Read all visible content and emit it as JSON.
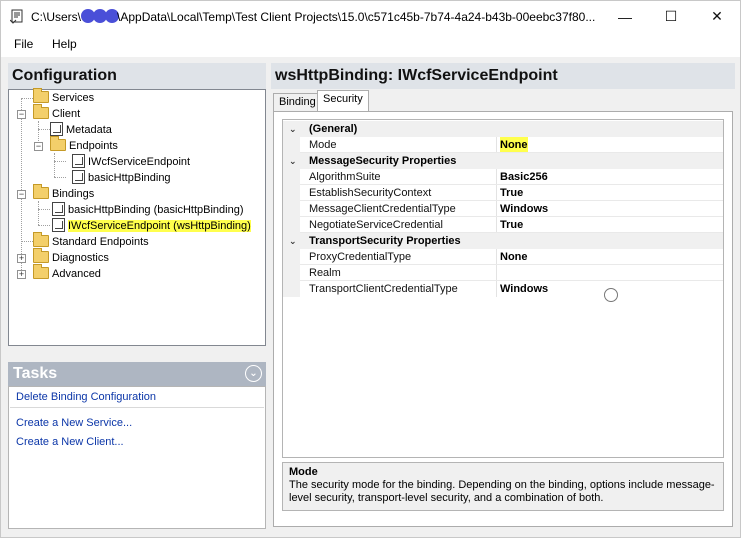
{
  "window": {
    "title_prefix": "C:\\Users\\",
    "title_suffix": "\\AppData\\Local\\Temp\\Test Client Projects\\15.0\\c571c45b-7b74-4a24-b43b-00eebc37f80...",
    "min_glyph": "—",
    "max_glyph": "☐",
    "close_glyph": "✕"
  },
  "menu": {
    "file": "File",
    "help": "Help"
  },
  "config": {
    "header": "Configuration",
    "tree": {
      "services": "Services",
      "client": "Client",
      "metadata": "Metadata",
      "endpoints": "Endpoints",
      "ep1": "IWcfServiceEndpoint",
      "ep2": "basicHttpBinding",
      "bindings": "Bindings",
      "b1": "basicHttpBinding (basicHttpBinding)",
      "b2": "IWcfServiceEndpoint (wsHttpBinding)",
      "standard": "Standard Endpoints",
      "diagnostics": "Diagnostics",
      "advanced": "Advanced",
      "minus": "−",
      "plus": "+"
    }
  },
  "tasks": {
    "header": "Tasks",
    "chevron": "⌄",
    "items": [
      "Delete Binding Configuration",
      "Create a New Service...",
      "Create a New Client..."
    ]
  },
  "detail": {
    "header": "wsHttpBinding: IWcfServiceEndpoint",
    "tabs": {
      "binding": "Binding",
      "security": "Security"
    },
    "cat_arrow": "⌄",
    "categories": {
      "general": "(General)",
      "message": "MessageSecurity Properties",
      "transport": "TransportSecurity Properties"
    },
    "props": {
      "mode": {
        "name": "Mode",
        "value": "None"
      },
      "algorithm": {
        "name": "AlgorithmSuite",
        "value": "Basic256"
      },
      "establish": {
        "name": "EstablishSecurityContext",
        "value": "True"
      },
      "msgcred": {
        "name": "MessageClientCredentialType",
        "value": "Windows"
      },
      "negotiate": {
        "name": "NegotiateServiceCredential",
        "value": "True"
      },
      "proxy": {
        "name": "ProxyCredentialType",
        "value": "None"
      },
      "realm": {
        "name": "Realm",
        "value": ""
      },
      "transcred": {
        "name": "TransportClientCredentialType",
        "value": "Windows"
      }
    },
    "description": {
      "title": "Mode",
      "text": "The security mode for the binding. Depending on the binding, options include message-level security, transport-level security, and a combination of both."
    }
  },
  "colors": {
    "highlight": "#ffff4d",
    "link": "#0b36a8",
    "header_bg": "#dfe3e8",
    "tasks_header_bg": "#aeb6c2"
  }
}
